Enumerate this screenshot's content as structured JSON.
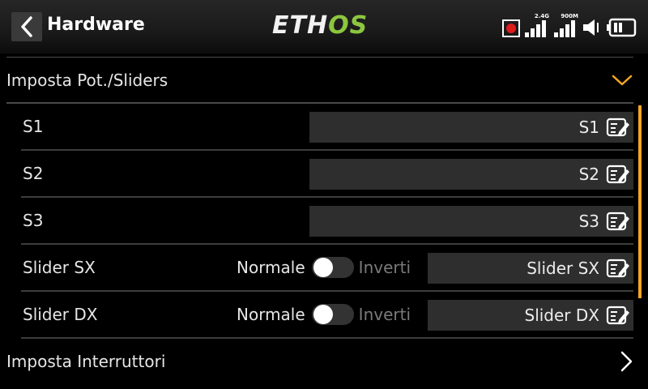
{
  "header": {
    "title": "Hardware",
    "logo_left": "ETH",
    "logo_right": "OS",
    "signal1_label": "2.4G",
    "signal2_label": "900M"
  },
  "sections": {
    "pots": {
      "label": "Imposta Pot./Sliders"
    },
    "switches": {
      "label": "Imposta Interruttori"
    }
  },
  "rows": [
    {
      "name": "S1",
      "value": "S1"
    },
    {
      "name": "S2",
      "value": "S2"
    },
    {
      "name": "S3",
      "value": "S3"
    },
    {
      "name": "Slider SX",
      "value": "Slider SX",
      "normal_label": "Normale",
      "invert_label": "Inverti"
    },
    {
      "name": "Slider DX",
      "value": "Slider DX",
      "normal_label": "Normale",
      "invert_label": "Inverti"
    }
  ],
  "colors": {
    "accent": "#f5a623",
    "logo_green": "#8cc63f",
    "record": "#e01b1b"
  }
}
